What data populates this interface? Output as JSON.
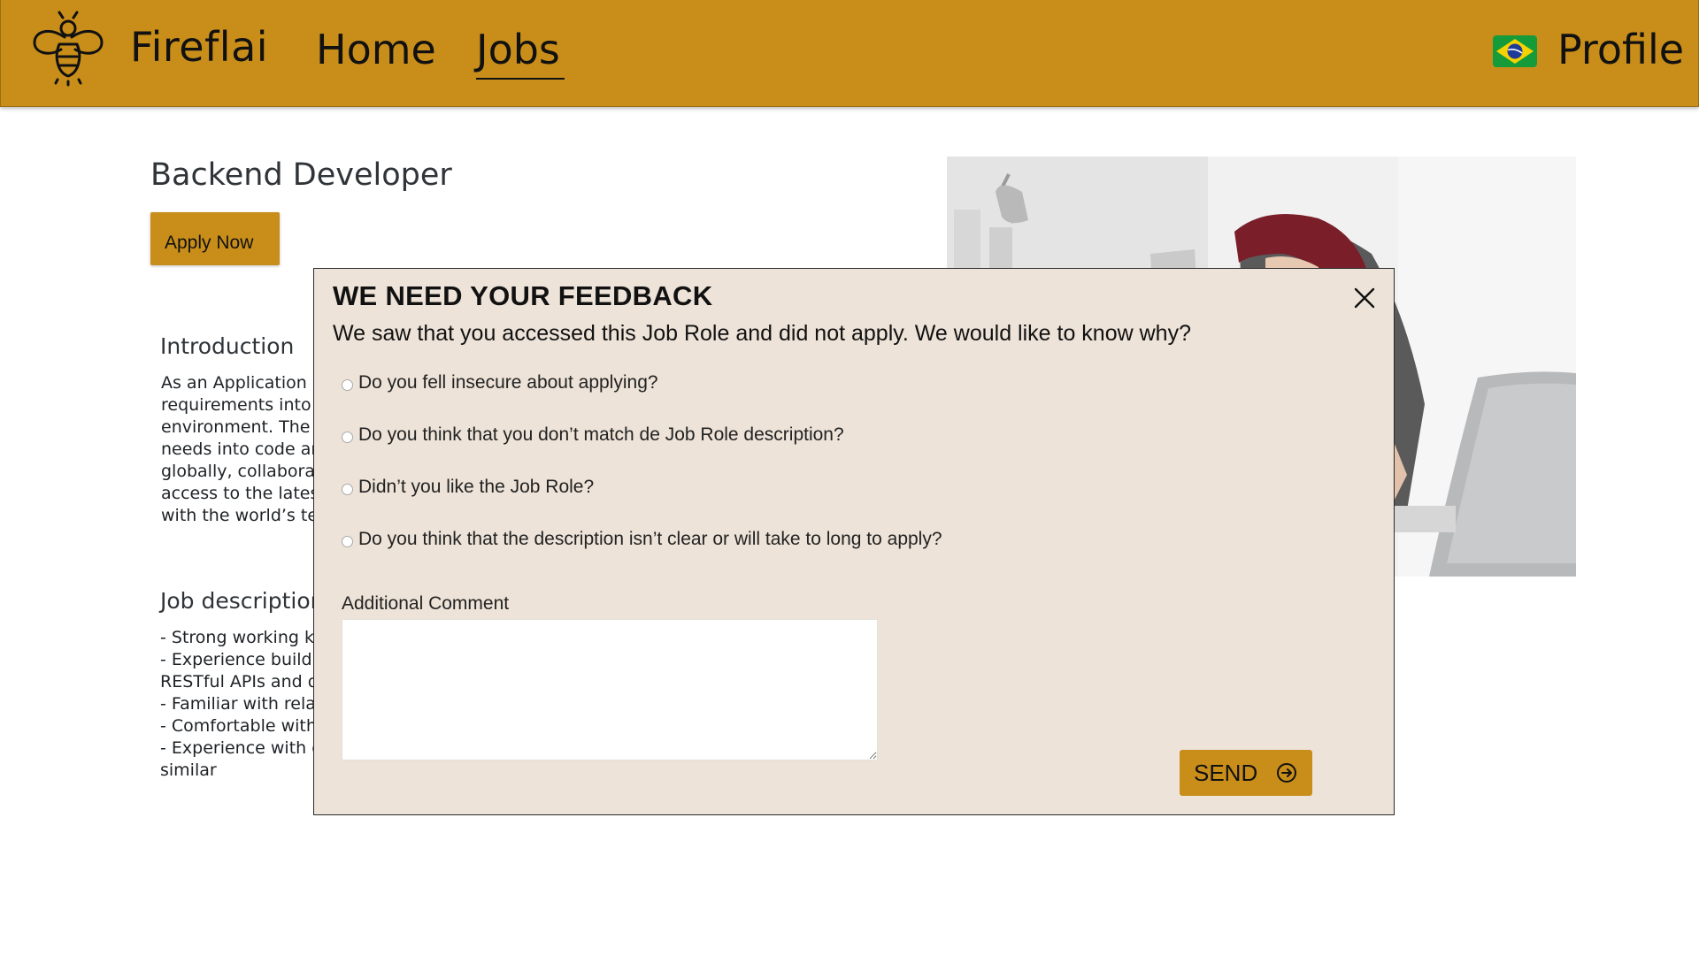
{
  "header": {
    "brand": "Fireflai",
    "nav": {
      "home": "Home",
      "jobs": "Jobs",
      "active": "Jobs"
    },
    "flag_icon": "brazil-flag-icon",
    "profile": "Profile",
    "colors": {
      "bar": "#c98e1a"
    }
  },
  "job": {
    "title": "Backend Developer",
    "apply_label": "Apply Now",
    "introduction": {
      "heading": "Introduction",
      "text": "As an Application D\nrequirements into t\nenvironment.  The s\nneeds into code an\nglobally, collaborati\naccess to the latest\nwith the world’s tec"
    },
    "description": {
      "heading": "Job description",
      "text": "- Strong working kn\n- Experience buildi\nRESTful APIs and d\n- Familiar with relat\n- Comfortable with \n- Experience with d\nsimilar"
    }
  },
  "feedback_modal": {
    "title": "WE NEED YOUR FEEDBACK",
    "subtitle": "We saw that you accessed this Job Role and did not apply. We would like to know why?",
    "options": [
      "Do you fell insecure about applying?",
      "Do you think that you don’t match de Job Role description?",
      "Didn’t you like the Job Role?",
      "Do you think that the description isn’t clear or will take to long to apply?"
    ],
    "comment_label": "Additional Comment",
    "comment_value": "",
    "send_label": "SEND",
    "colors": {
      "background": "#ede3d8",
      "button": "#c98e1a"
    }
  }
}
